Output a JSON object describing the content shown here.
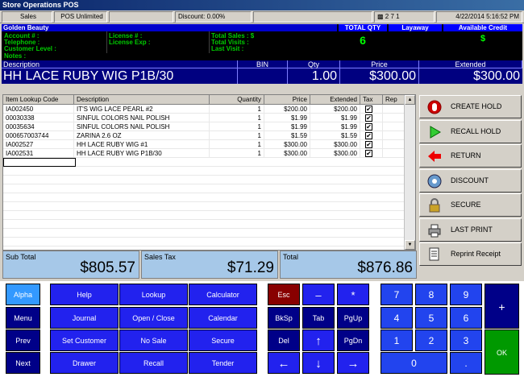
{
  "window": {
    "title": "Store Operations POS"
  },
  "status": {
    "store": "Sales",
    "product": "POS Unlimited",
    "field3": "",
    "discount": "Discount: 0.00%",
    "field5": "",
    "icons_text": "2 7 1",
    "datetime": "4/22/2014 5:16:52 PM"
  },
  "customer": {
    "name": "Golden Beauty",
    "account": "Account # :",
    "telephone": "Telephone :",
    "level": "Customer Level :",
    "license": "License # :",
    "license_exp": "License Exp :",
    "total_sales": "Total Sales : $",
    "total_visits": "Total Visits :",
    "last_visit": "Last Visit :",
    "notes": "Notes :",
    "total_qty_label": "TOTAL QTY",
    "total_qty": "6",
    "layaway_label": "Layaway",
    "layaway": "",
    "credit_label": "Available Credit",
    "credit": "$"
  },
  "current_item": {
    "h_desc": "Description",
    "h_bin": "BIN",
    "h_qty": "Qty",
    "h_price": "Price",
    "h_ext": "Extended",
    "desc": "HH LACE RUBY  WIG P1B/30",
    "bin": "",
    "qty": "1.00",
    "price": "$300.00",
    "ext": "$300.00"
  },
  "grid": {
    "headers": [
      "Item Lookup Code",
      "Description",
      "Quantity",
      "Price",
      "Extended",
      "Tax",
      "Rep"
    ],
    "rows": [
      {
        "code": "IA002450",
        "desc": "IT'S WIG LACE PEARL #2",
        "qty": "1",
        "price": "$200.00",
        "ext": "$200.00",
        "tax": true
      },
      {
        "code": "00030338",
        "desc": "SINFUL COLORS NAIL POLISH",
        "qty": "1",
        "price": "$1.99",
        "ext": "$1.99",
        "tax": true
      },
      {
        "code": "00035634",
        "desc": "SINFUL COLORS NAIL POLISH",
        "qty": "1",
        "price": "$1.99",
        "ext": "$1.99",
        "tax": true
      },
      {
        "code": "000657003744",
        "desc": "ZARINA 2.6 OZ",
        "qty": "1",
        "price": "$1.59",
        "ext": "$1.59",
        "tax": true
      },
      {
        "code": "IA002527",
        "desc": "HH LACE RUBY  WIG #1",
        "qty": "1",
        "price": "$300.00",
        "ext": "$300.00",
        "tax": true
      },
      {
        "code": "IA002531",
        "desc": "HH LACE RUBY  WIG P1B/30",
        "qty": "1",
        "price": "$300.00",
        "ext": "$300.00",
        "tax": true
      }
    ]
  },
  "functions": [
    {
      "label": "CREATE HOLD",
      "icon": "stop-icon"
    },
    {
      "label": "RECALL HOLD",
      "icon": "play-icon"
    },
    {
      "label": "RETURN",
      "icon": "return-arrow-icon"
    },
    {
      "label": "DISCOUNT",
      "icon": "discount-icon"
    },
    {
      "label": "SECURE",
      "icon": "lock-icon"
    },
    {
      "label": "LAST PRINT",
      "icon": "printer-icon"
    },
    {
      "label": "Reprint Receipt",
      "icon": "receipt-icon"
    }
  ],
  "totals": {
    "subtotal_label": "Sub Total",
    "subtotal": "$805.57",
    "tax_label": "Sales Tax",
    "tax": "$71.29",
    "total_label": "Total",
    "total": "$876.86"
  },
  "keys": {
    "alpha": "Alpha",
    "menu": "Menu",
    "prev": "Prev",
    "next": "Next",
    "help": "Help",
    "lookup": "Lookup",
    "calculator": "Calculator",
    "journal": "Journal",
    "openclose": "Open / Close",
    "calendar": "Calendar",
    "setcustomer": "Set Customer",
    "nosale": "No Sale",
    "secure": "Secure",
    "drawer": "Drawer",
    "recall": "Recall",
    "tender": "Tender",
    "esc": "Esc",
    "minus": "–",
    "star": "*",
    "bksp": "BkSp",
    "tab": "Tab",
    "pgup": "PgUp",
    "del": "Del",
    "up": "↑",
    "pgdn": "PgDn",
    "left": "←",
    "down": "↓",
    "right": "→",
    "n7": "7",
    "n8": "8",
    "n9": "9",
    "plus": "+",
    "n4": "4",
    "n5": "5",
    "n6": "6",
    "n1": "1",
    "n2": "2",
    "n3": "3",
    "ok": "OK",
    "n0": "0",
    "dot": "."
  },
  "colors": {
    "accent": "#0000ff",
    "totals_bg": "#a6c8e8",
    "ok_green": "#009900",
    "esc_red": "#880000"
  }
}
